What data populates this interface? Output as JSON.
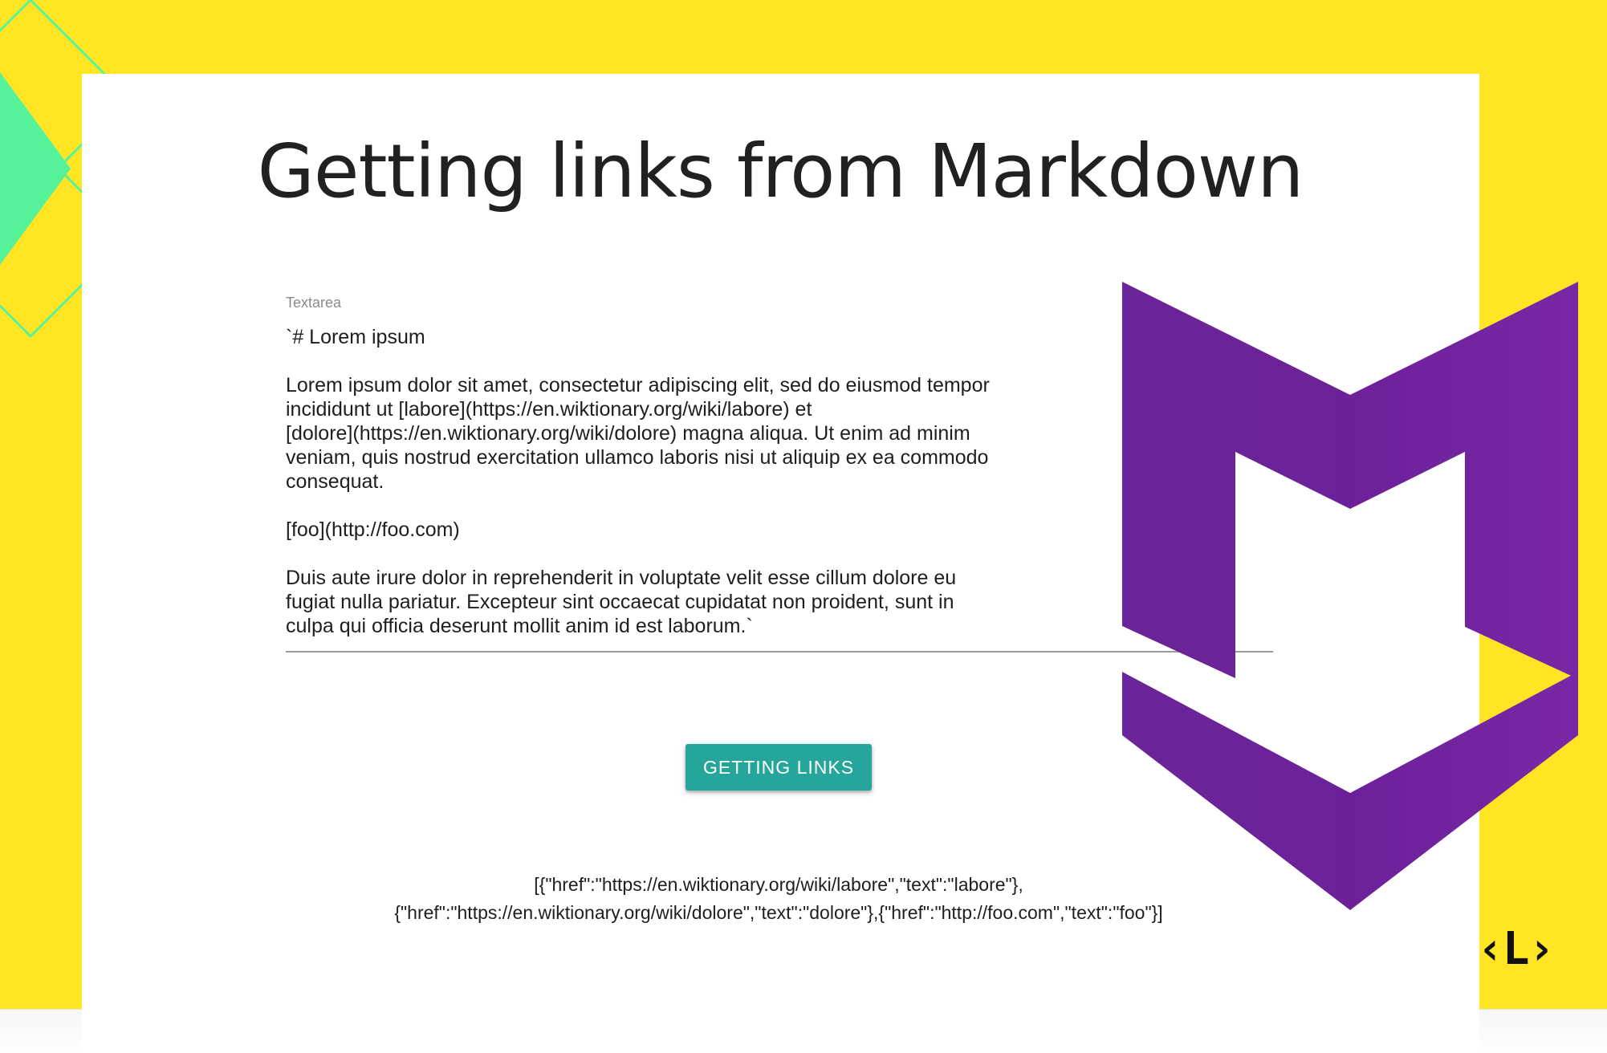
{
  "page": {
    "title": "Getting links from Markdown"
  },
  "textarea": {
    "label": "Textarea",
    "value": "`# Lorem ipsum\n\nLorem ipsum dolor sit amet, consectetur adipiscing elit, sed do eiusmod tempor\nincididunt ut [labore](https://en.wiktionary.org/wiki/labore) et\n[dolore](https://en.wiktionary.org/wiki/dolore) magna aliqua. Ut enim ad minim\nveniam, quis nostrud exercitation ullamco laboris nisi ut aliquip ex ea commodo\nconsequat.\n\n[foo](http://foo.com)\n\nDuis aute irure dolor in reprehenderit in voluptate velit esse cillum dolore eu\nfugiat nulla pariatur. Excepteur sint occaecat cupidatat non proident, sunt in\nculpa qui officia deserunt mollit anim id est laborum.`"
  },
  "actions": {
    "get_links_label": "GETTING LINKS"
  },
  "result": {
    "line1": "[{\"href\":\"https://en.wiktionary.org/wiki/labore\",\"text\":\"labore\"},",
    "line2": "{\"href\":\"https://en.wiktionary.org/wiki/dolore\",\"text\":\"dolore\"},{\"href\":\"http://foo.com\",\"text\":\"foo\"}]"
  },
  "branding": {
    "corner_logo": "‹L›",
    "markdown_logo_icon": "markdown-m-logo",
    "colors": {
      "background": "#ffe524",
      "accent_button": "#26a69a",
      "logo_purple": "#6f259f",
      "decor_green": "#55f29a"
    }
  }
}
